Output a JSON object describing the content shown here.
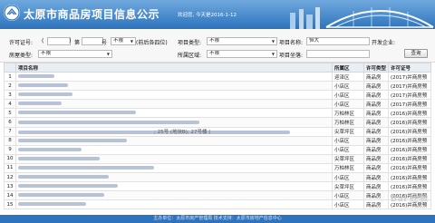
{
  "header": {
    "title": "太原市商品房项目信息公示",
    "welcome": "欢迎您, 今天是2016-1-12"
  },
  "search": {
    "license_label": "许可证号:",
    "license_paren_open": "(",
    "license_paren_close": ")",
    "di_label": "第",
    "hao_label": "号",
    "license_type_value": "不限",
    "license_hint": "(前后各四位)",
    "project_type_label": "项目类型:",
    "project_type_value": "不限",
    "project_name_label": "项目名称:",
    "project_name_value": "恒大",
    "developer_label": "开发企业:",
    "house_type_label": "房屋类型:",
    "house_type_value": "不限",
    "district_label": "所属区域:",
    "district_value": "不限",
    "address_label": "项目坐落:",
    "query_button": "查询"
  },
  "table": {
    "headers": {
      "idx": "",
      "name": "项目名称",
      "district": "所属区",
      "type": "许可类型",
      "license": "许可证号"
    },
    "rows": [
      {
        "idx": "1",
        "blur": 40,
        "district": "迎泽区",
        "type": "商品房",
        "license": "(2017)并商房预"
      },
      {
        "idx": "2",
        "blur": 55,
        "district": "小店区",
        "type": "商品房",
        "license": "(2017)并商房预"
      },
      {
        "idx": "3",
        "blur": 60,
        "district": "小店区",
        "type": "商品房",
        "license": "(2017)并商房预"
      },
      {
        "idx": "4",
        "blur": 48,
        "district": "小店区",
        "type": "商品房",
        "license": "(2017)并商房预"
      },
      {
        "idx": "5",
        "blur": 130,
        "district": "万柏林区",
        "type": "商品房",
        "license": "(2016)并商房预"
      },
      {
        "idx": "6",
        "blur": 200,
        "district": "万柏林区",
        "type": "商品房",
        "license": "(2016)并商房预"
      },
      {
        "idx": "7",
        "blur": 300,
        "district": "尖草坪区",
        "type": "商品房",
        "license": "(2016)并商房预",
        "mid": "; 25号 (地块B); 27号楼 ("
      },
      {
        "idx": "8",
        "blur": 120,
        "district": "小店区",
        "type": "商品房",
        "license": "(2016)并商房预"
      },
      {
        "idx": "9",
        "blur": 70,
        "district": "小店区",
        "type": "商品房",
        "license": "(2016)并商房预"
      },
      {
        "idx": "10",
        "blur": 90,
        "district": "尖草坪区",
        "type": "商品房",
        "license": "(2016)并商房预"
      },
      {
        "idx": "11",
        "blur": 150,
        "district": "万柏林区",
        "type": "商品房",
        "license": "(2016)并商房预"
      },
      {
        "idx": "12",
        "blur": 100,
        "district": "小店区",
        "type": "商品房",
        "license": "(2016)并商房预"
      },
      {
        "idx": "13",
        "blur": 110,
        "district": "尖草坪区",
        "type": "商品房",
        "license": "(2016)并商房预"
      },
      {
        "idx": "14",
        "blur": 95,
        "district": "小店区",
        "type": "商品房",
        "license": "(2016)并商房预"
      },
      {
        "idx": "15",
        "blur": 75,
        "district": "小店区",
        "type": "商品房",
        "license": "(2016)并商房预"
      }
    ]
  },
  "footer": {
    "text": "主办单位：太原市房产管理局   技术支持：太原市房地产信息中心"
  },
  "watermark": "Bai 经验",
  "colors": {
    "banner": "#2d73bd",
    "header_row": "#e9eef5"
  }
}
